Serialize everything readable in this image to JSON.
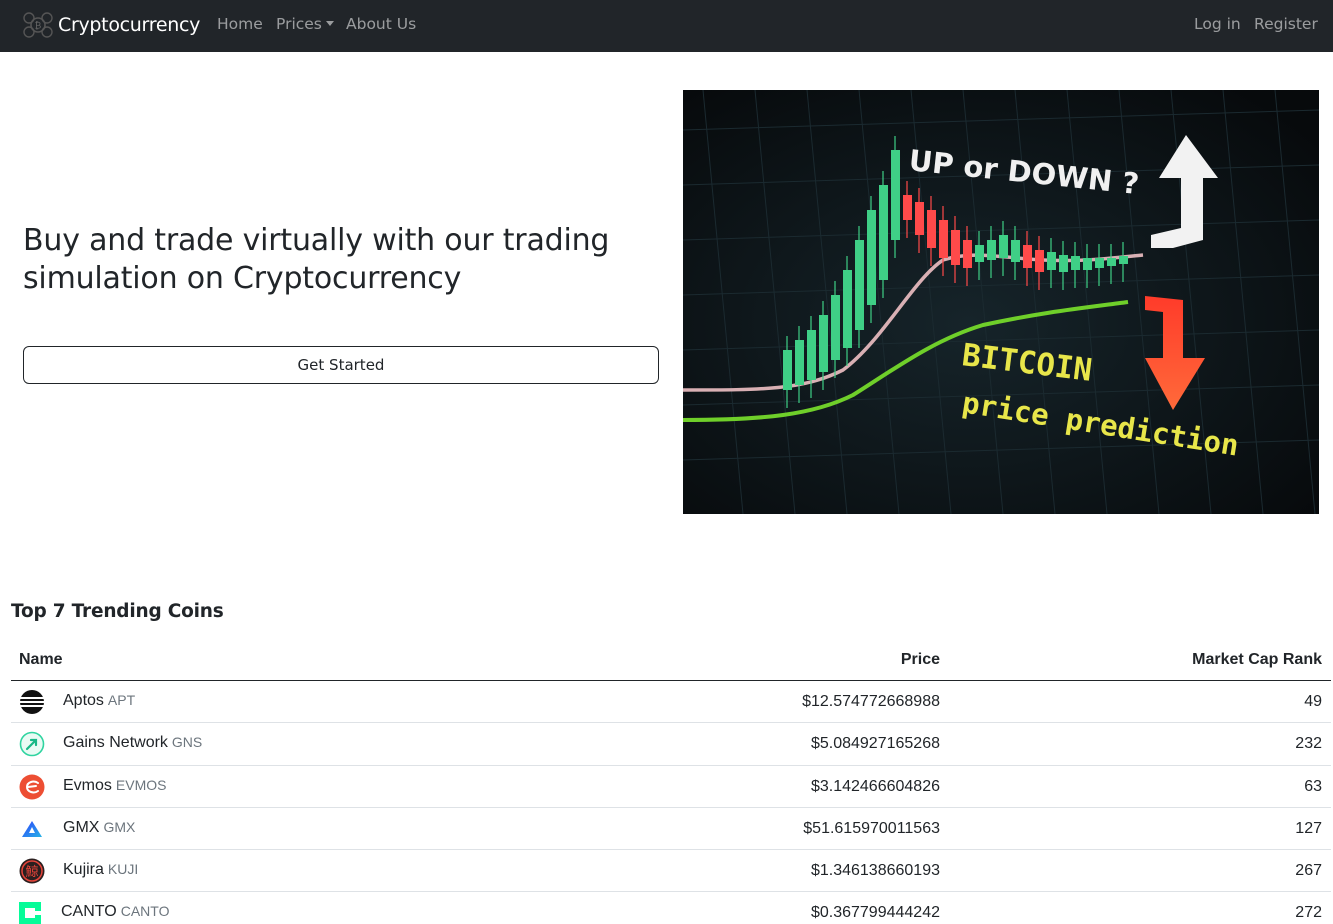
{
  "navbar": {
    "brand": "Cryptocurrency",
    "links": [
      "Home",
      "Prices",
      "About Us"
    ],
    "right_links": [
      "Log in",
      "Register"
    ]
  },
  "hero": {
    "title": "Buy and trade virtually with our trading simulation on Cryptocurrency",
    "button": "Get Started",
    "image_text": {
      "line1": "UP or DOWN ?",
      "line2": "BITCOIN",
      "line3": "price prediction"
    }
  },
  "trending": {
    "title": "Top 7 Trending Coins",
    "columns": [
      "Name",
      "Price",
      "Market Cap Rank"
    ],
    "rows": [
      {
        "name": "Aptos",
        "symbol": "APT",
        "price": "$12.574772668988",
        "rank": "49",
        "icon": "aptos-icon"
      },
      {
        "name": "Gains Network",
        "symbol": "GNS",
        "price": "$5.084927165268",
        "rank": "232",
        "icon": "gains-network-icon"
      },
      {
        "name": "Evmos",
        "symbol": "EVMOS",
        "price": "$3.142466604826",
        "rank": "63",
        "icon": "evmos-icon"
      },
      {
        "name": "GMX",
        "symbol": "GMX",
        "price": "$51.615970011563",
        "rank": "127",
        "icon": "gmx-icon"
      },
      {
        "name": "Kujira",
        "symbol": "KUJI",
        "price": "$1.346138660193",
        "rank": "267",
        "icon": "kujira-icon"
      },
      {
        "name": "CANTO",
        "symbol": "CANTO",
        "price": "$0.367799444242",
        "rank": "272",
        "icon": "canto-icon"
      }
    ]
  },
  "colors": {
    "navbar_bg": "#212529",
    "candle_up": "#3fcf86",
    "candle_down": "#ff4a4a",
    "image_text_yellow": "#e8e64a"
  }
}
